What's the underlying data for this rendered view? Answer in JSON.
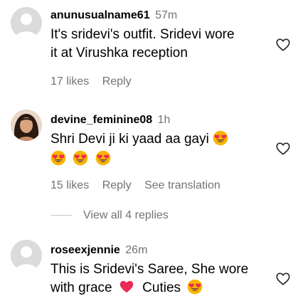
{
  "comments": [
    {
      "username": "anunusualname61",
      "time": "57m",
      "text_line1": "It's sridevi's outfit. Sridevi wore",
      "text_line2": "it at Virushka reception",
      "likes": "17 likes",
      "reply": "Reply",
      "avatar": "default-avatar"
    },
    {
      "username": "devine_feminine08",
      "time": "1h",
      "text_line1": "Shri Devi ji ki yaad aa gayi",
      "likes": "15 likes",
      "reply": "Reply",
      "translate": "See translation",
      "avatar": "profile-photo"
    },
    {
      "username": "roseexjennie",
      "time": "26m",
      "text_line1": "This is Sridevi's Saree, She wore",
      "text_line2_a": "with grace",
      "text_line2_b": "Cuties",
      "avatar": "default-avatar"
    }
  ],
  "view_replies": "View all 4 replies",
  "icons": {
    "like": "heart-outline-icon",
    "emoji": "heart-eyes-emoji",
    "red_heart": "red-heart-emoji"
  },
  "colors": {
    "secondary_text": "#737373",
    "emoji_face": "#f7b500",
    "emoji_heart": "#ed2a55"
  }
}
